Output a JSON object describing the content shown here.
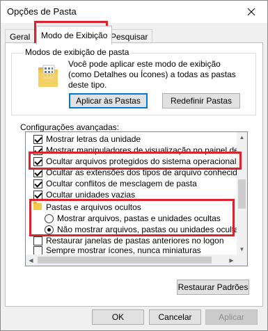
{
  "window": {
    "title": "Opções de Pasta"
  },
  "tabs": [
    {
      "label": "Geral"
    },
    {
      "label": "Modo de Exibição"
    },
    {
      "label": "Pesquisar"
    }
  ],
  "folder_views": {
    "group_title": "Modos de exibição de pasta",
    "description": "Você pode aplicar este modo de exibição (como Detalhes ou Ícones) a todas as pastas deste tipo.",
    "apply_button": "Aplicar às Pastas",
    "reset_button": "Redefinir Pastas"
  },
  "advanced": {
    "label": "Configurações avançadas:",
    "items": [
      {
        "type": "checkbox",
        "checked": true,
        "label": "Mostrar letras da unidade"
      },
      {
        "type": "checkbox",
        "checked": true,
        "label": "Mostrar manipuladores de visualização no painel de visua"
      },
      {
        "type": "checkbox",
        "checked": true,
        "label": "Ocultar arquivos protegidos do sistema operacional (Reco"
      },
      {
        "type": "checkbox",
        "checked": true,
        "label": "Ocultar as extensões dos tipos de arquivo conhecidos"
      },
      {
        "type": "checkbox",
        "checked": true,
        "label": "Ocultar conflitos de mesclagem de pasta"
      },
      {
        "type": "checkbox",
        "checked": true,
        "label": "Ocultar unidades vazias"
      },
      {
        "type": "folder",
        "label": "Pastas e arquivos ocultos"
      },
      {
        "type": "radio",
        "checked": false,
        "label": "Mostrar arquivos, pastas e unidades ocultas"
      },
      {
        "type": "radio",
        "checked": true,
        "label": "Não mostrar arquivos, pastas ou unidades ocultas"
      },
      {
        "type": "checkbox",
        "checked": false,
        "label": "Restaurar janelas de pastas anteriores no logon"
      },
      {
        "type": "checkbox",
        "checked": false,
        "label": "Sempre mostrar ícones, nunca miniaturas"
      }
    ]
  },
  "restore_defaults_button": "Restaurar Padrões",
  "footer": {
    "ok": "OK",
    "cancel": "Cancelar",
    "apply": "Aplicar"
  },
  "colors": {
    "highlight": "#d9232d",
    "accent": "#0078d7"
  }
}
